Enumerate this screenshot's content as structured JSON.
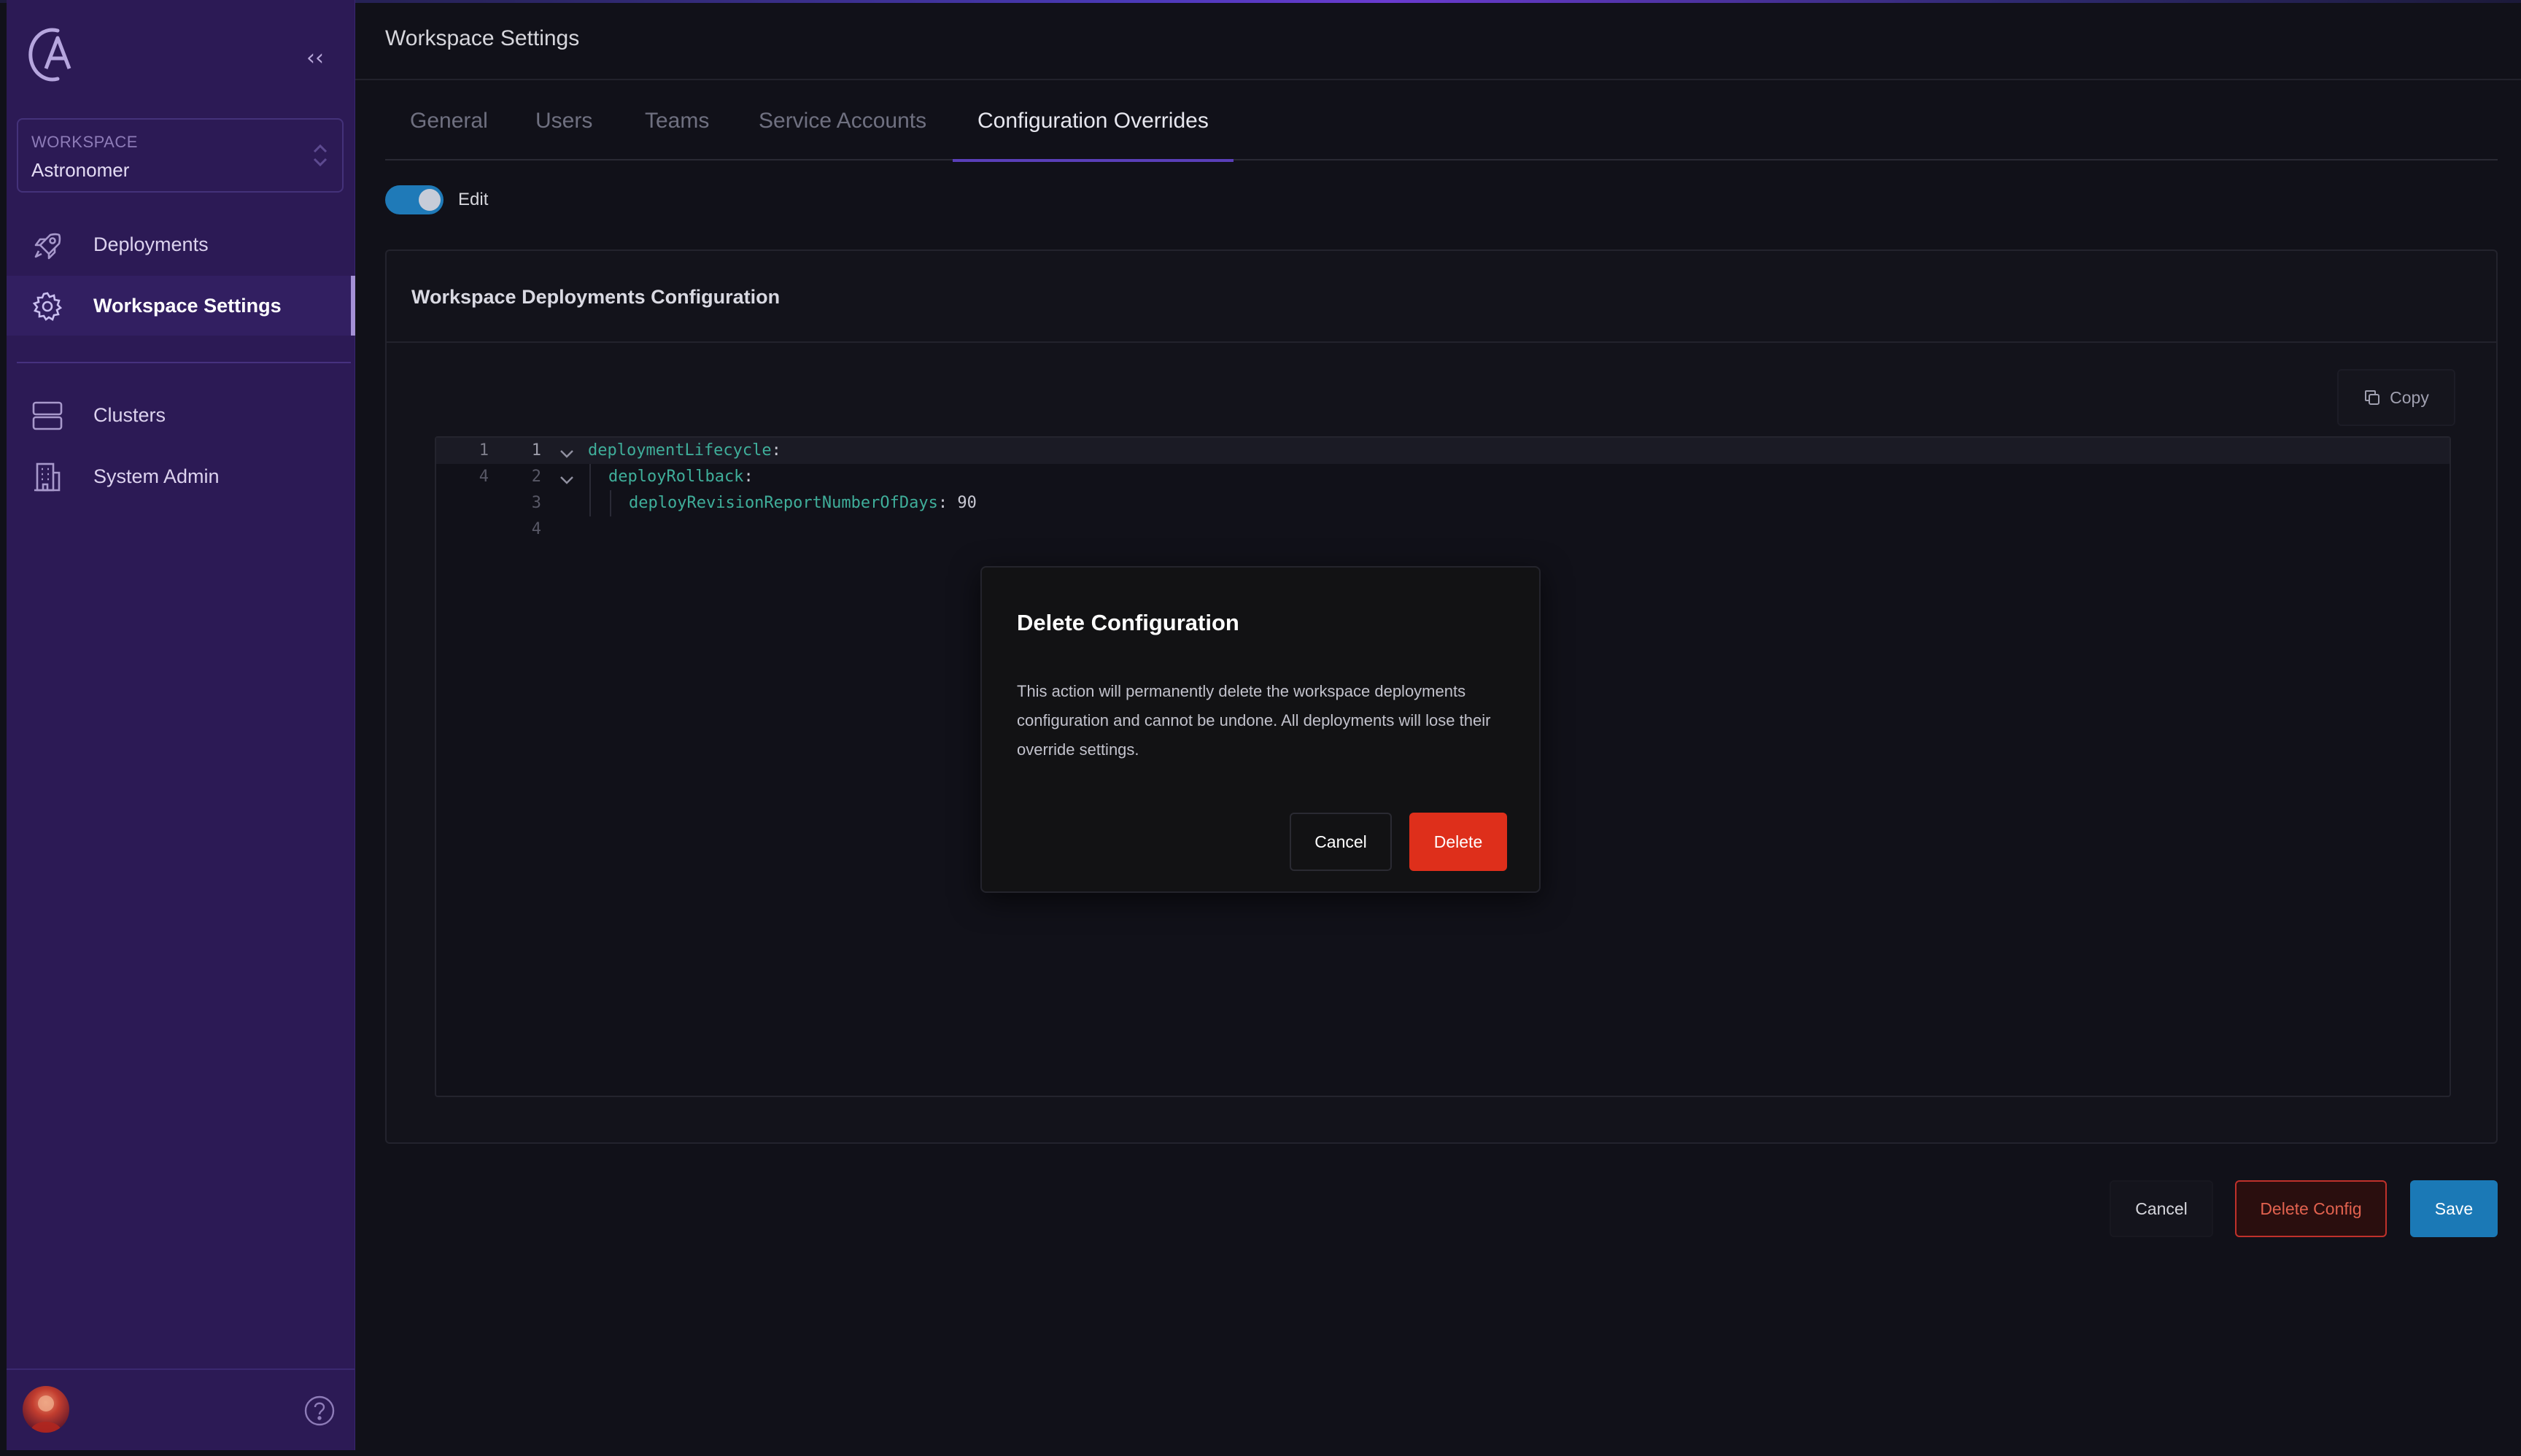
{
  "sidebar": {
    "collapse_glyph": "‹‹",
    "workspace_label": "WORKSPACE",
    "workspace_value": "Astronomer",
    "items": [
      {
        "label": "Deployments",
        "icon": "rocket-icon"
      },
      {
        "label": "Workspace Settings",
        "icon": "gear-icon"
      },
      {
        "label": "Clusters",
        "icon": "server-icon"
      },
      {
        "label": "System Admin",
        "icon": "building-icon"
      }
    ]
  },
  "header": {
    "title": "Workspace Settings"
  },
  "tabs": [
    {
      "label": "General"
    },
    {
      "label": "Users"
    },
    {
      "label": "Teams"
    },
    {
      "label": "Service Accounts"
    },
    {
      "label": "Configuration Overrides"
    }
  ],
  "active_tab": "Configuration Overrides",
  "edit_toggle": {
    "label": "Edit",
    "on": true
  },
  "config_card": {
    "title": "Workspace Deployments Configuration",
    "copy_label": "Copy"
  },
  "editor": {
    "lines": [
      {
        "old": "1",
        "new": "1",
        "key": "deploymentLifecycle",
        "punc": ":",
        "value": ""
      },
      {
        "old": "4",
        "new": "2",
        "key": "deployRollback",
        "punc": ":",
        "value": ""
      },
      {
        "old": "",
        "new": "3",
        "key": "deployRevisionReportNumberOfDays",
        "punc": ": ",
        "value": "90"
      },
      {
        "old": "",
        "new": "4",
        "key": "",
        "punc": "",
        "value": ""
      }
    ]
  },
  "actions": {
    "cancel_label": "Cancel",
    "delete_label": "Delete Config",
    "save_label": "Save"
  },
  "modal": {
    "title": "Delete Configuration",
    "body": "This action will permanently delete the workspace deployments configuration and cannot be undone. All deployments will lose their override settings.",
    "cancel_label": "Cancel",
    "delete_label": "Delete"
  },
  "colors": {
    "sidebar_bg": "#2c1a55",
    "accent_purple": "#5a3fb8",
    "toggle_blue": "#1f7ab8",
    "danger_red": "#de2f1b",
    "save_blue": "#1b79b6",
    "code_key": "#3fae9a"
  }
}
